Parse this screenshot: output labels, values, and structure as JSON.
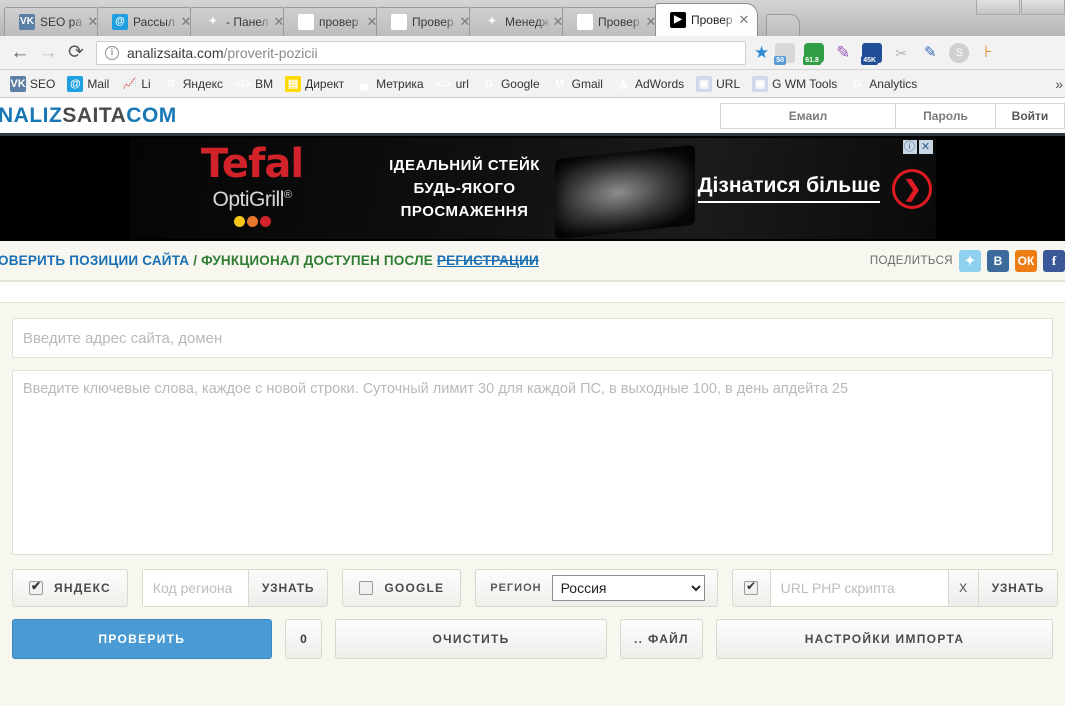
{
  "browser": {
    "tabs": [
      {
        "favicon": "vk-icon",
        "label": "SEO ра"
      },
      {
        "favicon": "at-icon",
        "label": "Рассыл"
      },
      {
        "favicon": "joomla-icon",
        "label": "- Панел"
      },
      {
        "favicon": "ab-icon",
        "label": "провер"
      },
      {
        "favicon": "ab-icon",
        "label": "Провер"
      },
      {
        "favicon": "joomla-icon",
        "label": "Менедж"
      },
      {
        "favicon": "ab-icon",
        "label": "Провер"
      },
      {
        "favicon": "green-icon",
        "label": "Провер"
      }
    ],
    "active_tab_index": 7,
    "tab_close_glyph": "✕",
    "nav": {
      "back_glyph": "←",
      "forward_glyph": "→",
      "reload_glyph": "⟳",
      "info_glyph": "i",
      "star_glyph": "★"
    },
    "url": {
      "host": "analizsaita.com",
      "path": "/proverit-pozicii"
    },
    "extensions": [
      {
        "name": "seo-meter-icon",
        "badge": "50"
      },
      {
        "name": "pr-badge-icon",
        "badge": "61.8",
        "glyph": "S"
      },
      {
        "name": "feather-icon",
        "glyph": "✎"
      },
      {
        "name": "traffic-icon",
        "badge": "45K",
        "glyph": "↗"
      },
      {
        "name": "clip-icon",
        "glyph": "✂"
      },
      {
        "name": "eyedropper-icon",
        "glyph": "✎"
      },
      {
        "name": "skype-icon",
        "glyph": "S"
      },
      {
        "name": "ruler-icon",
        "glyph": "⊦"
      }
    ],
    "bookmarks": [
      {
        "icon": "vk-icon",
        "label": "SEO"
      },
      {
        "icon": "mail-icon",
        "label": "Mail"
      },
      {
        "icon": "chart-icon",
        "label": "Li"
      },
      {
        "icon": "yandex-icon",
        "label": "Яндекс"
      },
      {
        "icon": "code-icon",
        "label": "BM"
      },
      {
        "icon": "direct-icon",
        "label": "Директ"
      },
      {
        "icon": "metrika-icon",
        "label": "Метрика"
      },
      {
        "icon": "code-icon",
        "label": "url"
      },
      {
        "icon": "google-icon",
        "label": "Google"
      },
      {
        "icon": "gmail-icon",
        "label": "Gmail"
      },
      {
        "icon": "adwords-icon",
        "label": "AdWords"
      },
      {
        "icon": "url-icon",
        "label": "URL"
      },
      {
        "icon": "url-icon",
        "label": "G WM Tools"
      },
      {
        "icon": "google-icon",
        "label": "Analytics"
      }
    ],
    "bookmarks_overflow_glyph": "»"
  },
  "site": {
    "logo": {
      "part_blue_1": "NALIZ",
      "part_dark": "SAITA",
      "part_blue_2": "COM"
    },
    "login": {
      "email_label": "Емаил",
      "password_label": "Пароль",
      "submit_label": "Войти"
    }
  },
  "ad": {
    "brand": "Tefal",
    "product_line": "OptiGrill",
    "registered_mark": "®",
    "slogan_lines": [
      "ІДЕАЛЬНИЙ СТЕЙК",
      "БУДЬ-ЯКОГО",
      "ПРОСМАЖЕННЯ"
    ],
    "cta_text": "Дізнатися більше",
    "cta_arrow_glyph": "❯",
    "info_glyph": "ⓘ",
    "close_glyph": "✕"
  },
  "breadcrumb": {
    "title": "ОВЕРИТЬ ПОЗИЦИИ САЙТА",
    "separator": " / ",
    "subtitle": "ФУНКЦИОНАЛ ДОСТУПЕН ПОСЛЕ ",
    "link": "РЕГИСТРАЦИИ"
  },
  "share": {
    "label": "ПОДЕЛИТЬСЯ",
    "buttons": [
      {
        "name": "twitter-share-icon",
        "glyph": "🐦"
      },
      {
        "name": "vkontakte-share-icon",
        "glyph": "В"
      },
      {
        "name": "odnoklassniki-share-icon",
        "glyph": "ОК"
      },
      {
        "name": "facebook-share-icon",
        "glyph": "f"
      }
    ]
  },
  "form": {
    "site_input": {
      "placeholder": "Введите адрес сайта, домен",
      "value": ""
    },
    "keywords_input": {
      "placeholder": "Введите ключевые слова, каждое с новой строки. Суточный лимит 30 для каждой ПС, в выходные 100, в день апдейта 25",
      "value": ""
    },
    "controls": {
      "yandex_label": "ЯНДЕКС",
      "yandex_checked": true,
      "region_code_placeholder": "Код региона",
      "region_code_value": "",
      "region_code_button": "УЗНАТЬ",
      "google_label": "GOOGLE",
      "google_checked": false,
      "region_label": "РЕГИОН",
      "region_selected": "Россия",
      "region_options": [
        "Россия"
      ],
      "php_checked": true,
      "php_placeholder": "URL PHP скрипта",
      "php_value": "",
      "php_clear_label": "X",
      "php_button": "УЗНАТЬ"
    },
    "buttons": {
      "check": "ПРОВЕРИТЬ",
      "count": "0",
      "clear": "ОЧИСТИТЬ",
      "file": ".. ФАЙЛ",
      "import": "НАСТРОЙКИ ИМПОРТА"
    }
  }
}
